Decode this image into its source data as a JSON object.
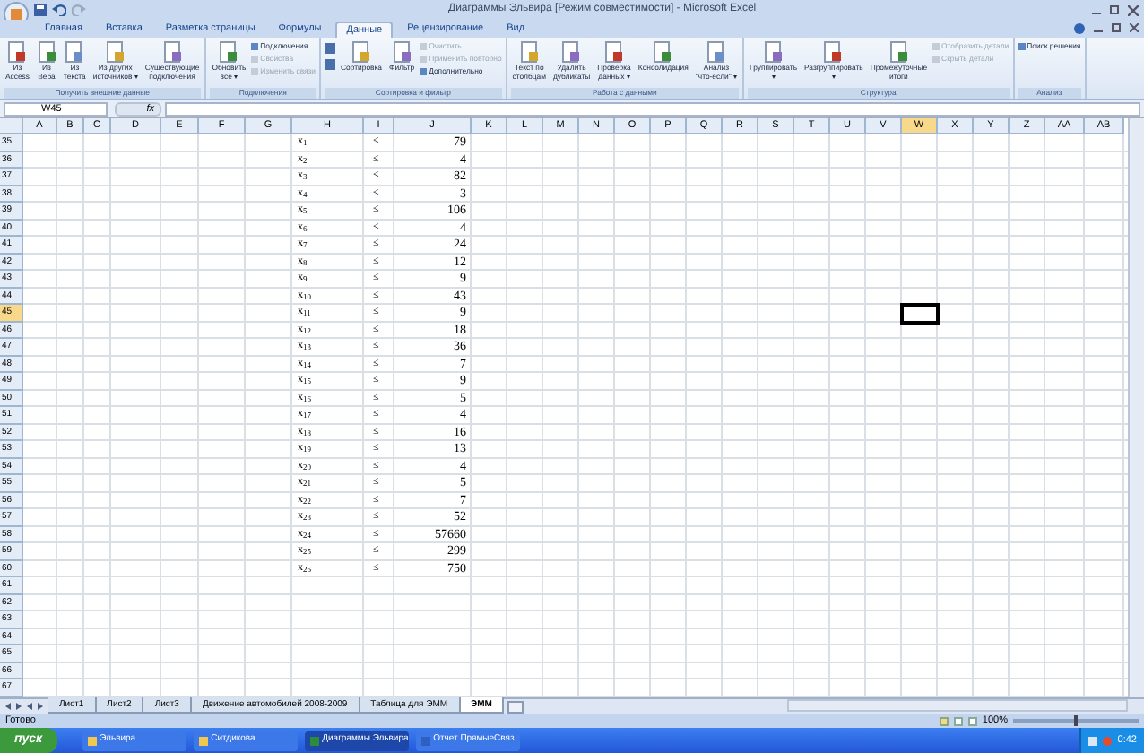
{
  "window": {
    "title": "Диаграммы Эльвира  [Режим совместимости] - Microsoft Excel"
  },
  "tabs": [
    {
      "label": "Главная",
      "selected": false
    },
    {
      "label": "Вставка",
      "selected": false
    },
    {
      "label": "Разметка страницы",
      "selected": false
    },
    {
      "label": "Формулы",
      "selected": false
    },
    {
      "label": "Данные",
      "selected": true
    },
    {
      "label": "Рецензирование",
      "selected": false
    },
    {
      "label": "Вид",
      "selected": false
    }
  ],
  "ribbon_groups": [
    {
      "label": "Получить внешние данные",
      "buttons": [
        {
          "kind": "large",
          "lines": [
            "Из",
            "Access"
          ],
          "disabled": false
        },
        {
          "kind": "large",
          "lines": [
            "Из",
            "Веба"
          ],
          "disabled": false
        },
        {
          "kind": "large",
          "lines": [
            "Из",
            "текста"
          ],
          "disabled": false
        },
        {
          "kind": "large",
          "lines": [
            "Из других",
            "источников ▾"
          ],
          "disabled": false
        },
        {
          "kind": "large",
          "lines": [
            "Существующие",
            "подключения"
          ],
          "disabled": false
        }
      ]
    },
    {
      "label": "Подключения",
      "buttons": [
        {
          "kind": "large",
          "lines": [
            "Обновить",
            "все ▾"
          ],
          "disabled": false
        },
        {
          "kind": "small",
          "lines": [
            "Подключения"
          ],
          "disabled": false
        },
        {
          "kind": "small",
          "lines": [
            "Свойства"
          ],
          "disabled": true
        },
        {
          "kind": "small",
          "lines": [
            "Изменить связи"
          ],
          "disabled": true
        }
      ]
    },
    {
      "label": "Сортировка и фильтр",
      "buttons": [
        {
          "kind": "sort",
          "disabled": false
        },
        {
          "kind": "large",
          "lines": [
            "Сортировка"
          ],
          "disabled": false
        },
        {
          "kind": "large",
          "lines": [
            "Фильтр"
          ],
          "disabled": false
        },
        {
          "kind": "small",
          "lines": [
            "Очистить"
          ],
          "disabled": true
        },
        {
          "kind": "small",
          "lines": [
            "Применить повторно"
          ],
          "disabled": true
        },
        {
          "kind": "small",
          "lines": [
            "Дополнительно"
          ],
          "disabled": false
        }
      ]
    },
    {
      "label": "Работа с данными",
      "buttons": [
        {
          "kind": "large",
          "lines": [
            "Текст по",
            "столбцам"
          ],
          "disabled": false
        },
        {
          "kind": "large",
          "lines": [
            "Удалить",
            "дубликаты"
          ],
          "disabled": false
        },
        {
          "kind": "large",
          "lines": [
            "Проверка",
            "данных ▾"
          ],
          "disabled": false
        },
        {
          "kind": "large",
          "lines": [
            "Консолидация"
          ],
          "disabled": false
        },
        {
          "kind": "large",
          "lines": [
            "Анализ",
            "\"что-если\" ▾"
          ],
          "disabled": false
        }
      ]
    },
    {
      "label": "Структура",
      "buttons": [
        {
          "kind": "large",
          "lines": [
            "Группировать",
            "▾"
          ],
          "disabled": false
        },
        {
          "kind": "large",
          "lines": [
            "Разгруппировать",
            "▾"
          ],
          "disabled": false
        },
        {
          "kind": "large",
          "lines": [
            "Промежуточные",
            "итоги"
          ],
          "disabled": false
        },
        {
          "kind": "small",
          "lines": [
            "Отобразить детали"
          ],
          "disabled": true
        },
        {
          "kind": "small",
          "lines": [
            "Скрыть детали"
          ],
          "disabled": true
        }
      ]
    },
    {
      "label": "Анализ",
      "buttons": [
        {
          "kind": "small",
          "lines": [
            "Поиск решения"
          ],
          "disabled": false
        }
      ]
    }
  ],
  "formula_bar": {
    "name_box": "W45",
    "fx": "fx"
  },
  "column_headers": [
    {
      "label": "A",
      "selected": false
    },
    {
      "label": "B",
      "selected": false
    },
    {
      "label": "C",
      "selected": false
    },
    {
      "label": "D",
      "selected": false
    },
    {
      "label": "E",
      "selected": false
    },
    {
      "label": "F",
      "selected": false
    },
    {
      "label": "G",
      "selected": false
    },
    {
      "label": "H",
      "selected": false
    },
    {
      "label": "I",
      "selected": false
    },
    {
      "label": "J",
      "selected": false
    },
    {
      "label": "K",
      "selected": false
    },
    {
      "label": "L",
      "selected": false
    },
    {
      "label": "M",
      "selected": false
    },
    {
      "label": "N",
      "selected": false
    },
    {
      "label": "O",
      "selected": false
    },
    {
      "label": "P",
      "selected": false
    },
    {
      "label": "Q",
      "selected": false
    },
    {
      "label": "R",
      "selected": false
    },
    {
      "label": "S",
      "selected": false
    },
    {
      "label": "T",
      "selected": false
    },
    {
      "label": "U",
      "selected": false
    },
    {
      "label": "V",
      "selected": false
    },
    {
      "label": "W",
      "selected": true
    },
    {
      "label": "X",
      "selected": false
    },
    {
      "label": "Y",
      "selected": false
    },
    {
      "label": "Z",
      "selected": false
    },
    {
      "label": "AA",
      "selected": false
    },
    {
      "label": "AB",
      "selected": false
    }
  ],
  "rows": [
    {
      "number": "35",
      "selected": false,
      "H": "x$_{1}$",
      "I": "≤",
      "J": "79"
    },
    {
      "number": "36",
      "selected": false,
      "H": "x$_{2}$",
      "I": "≤",
      "J": "4"
    },
    {
      "number": "37",
      "selected": false,
      "H": "x$_{3}$",
      "I": "≤",
      "J": "82"
    },
    {
      "number": "38",
      "selected": false,
      "H": "x$_{4}$",
      "I": "≤",
      "J": "3"
    },
    {
      "number": "39",
      "selected": false,
      "H": "x$_{5}$",
      "I": "≤",
      "J": "106"
    },
    {
      "number": "40",
      "selected": false,
      "H": "x$_{6}$",
      "I": "≤",
      "J": "4"
    },
    {
      "number": "41",
      "selected": false,
      "H": "x$_{7}$",
      "I": "≤",
      "J": "24"
    },
    {
      "number": "42",
      "selected": false,
      "H": "x$_{8}$",
      "I": "≤",
      "J": "12"
    },
    {
      "number": "43",
      "selected": false,
      "H": "x$_{9}$",
      "I": "≤",
      "J": "9"
    },
    {
      "number": "44",
      "selected": false,
      "H": "x$_{10}$",
      "I": "≤",
      "J": "43"
    },
    {
      "number": "45",
      "selected": true,
      "H": "x$_{11}$",
      "I": "≤",
      "J": "9"
    },
    {
      "number": "46",
      "selected": false,
      "H": "x$_{12}$",
      "I": "≤",
      "J": "18"
    },
    {
      "number": "47",
      "selected": false,
      "H": "x$_{13}$",
      "I": "≤",
      "J": "36"
    },
    {
      "number": "48",
      "selected": false,
      "H": "x$_{14}$",
      "I": "≤",
      "J": "7"
    },
    {
      "number": "49",
      "selected": false,
      "H": "x$_{15}$",
      "I": "≤",
      "J": "9"
    },
    {
      "number": "50",
      "selected": false,
      "H": "x$_{16}$",
      "I": "≤",
      "J": "5"
    },
    {
      "number": "51",
      "selected": false,
      "H": "x$_{17}$",
      "I": "≤",
      "J": "4"
    },
    {
      "number": "52",
      "selected": false,
      "H": "x$_{18}$",
      "I": "≤",
      "J": "16"
    },
    {
      "number": "53",
      "selected": false,
      "H": "x$_{19}$",
      "I": "≤",
      "J": "13"
    },
    {
      "number": "54",
      "selected": false,
      "H": "x$_{20}$",
      "I": "≤",
      "J": "4"
    },
    {
      "number": "55",
      "selected": false,
      "H": "x$_{21}$",
      "I": "≤",
      "J": "5"
    },
    {
      "number": "56",
      "selected": false,
      "H": "x$_{22}$",
      "I": "≤",
      "J": "7"
    },
    {
      "number": "57",
      "selected": false,
      "H": "x$_{23}$",
      "I": "≤",
      "J": "52"
    },
    {
      "number": "58",
      "selected": false,
      "H": "x$_{24}$",
      "I": "≤",
      "J": "57660"
    },
    {
      "number": "59",
      "selected": false,
      "H": "x$_{25}$",
      "I": "≤",
      "J": "299"
    },
    {
      "number": "60",
      "selected": false,
      "H": "x$_{26}$",
      "I": "≤",
      "J": "750"
    },
    {
      "number": "61",
      "selected": false
    },
    {
      "number": "62",
      "selected": false
    },
    {
      "number": "63",
      "selected": false
    },
    {
      "number": "64",
      "selected": false
    },
    {
      "number": "65",
      "selected": false
    },
    {
      "number": "66",
      "selected": false
    },
    {
      "number": "67",
      "selected": false
    }
  ],
  "sheet_tabs": [
    {
      "label": "Лист1",
      "selected": false
    },
    {
      "label": "Лист2",
      "selected": false
    },
    {
      "label": "Лист3",
      "selected": false
    },
    {
      "label": "Движение автомобилей 2008-2009",
      "selected": false
    },
    {
      "label": "Таблица для ЭММ",
      "selected": false
    },
    {
      "label": "ЭММ",
      "selected": true
    }
  ],
  "status_bar": {
    "text": "Готово",
    "zoom": "100%",
    "zoom_slider": {
      "level": 0.5
    }
  },
  "taskbar": {
    "start": "пуск",
    "items": [
      {
        "label": "Эльвира",
        "kind": "folder",
        "selected": false
      },
      {
        "label": "Ситдикова",
        "kind": "folder",
        "selected": false
      },
      {
        "label": "Диаграммы Эльвира...",
        "kind": "excel",
        "selected": true
      },
      {
        "label": "Отчет ПрямыеСвяз...",
        "kind": "word",
        "selected": false
      }
    ],
    "clock": "0:42"
  }
}
